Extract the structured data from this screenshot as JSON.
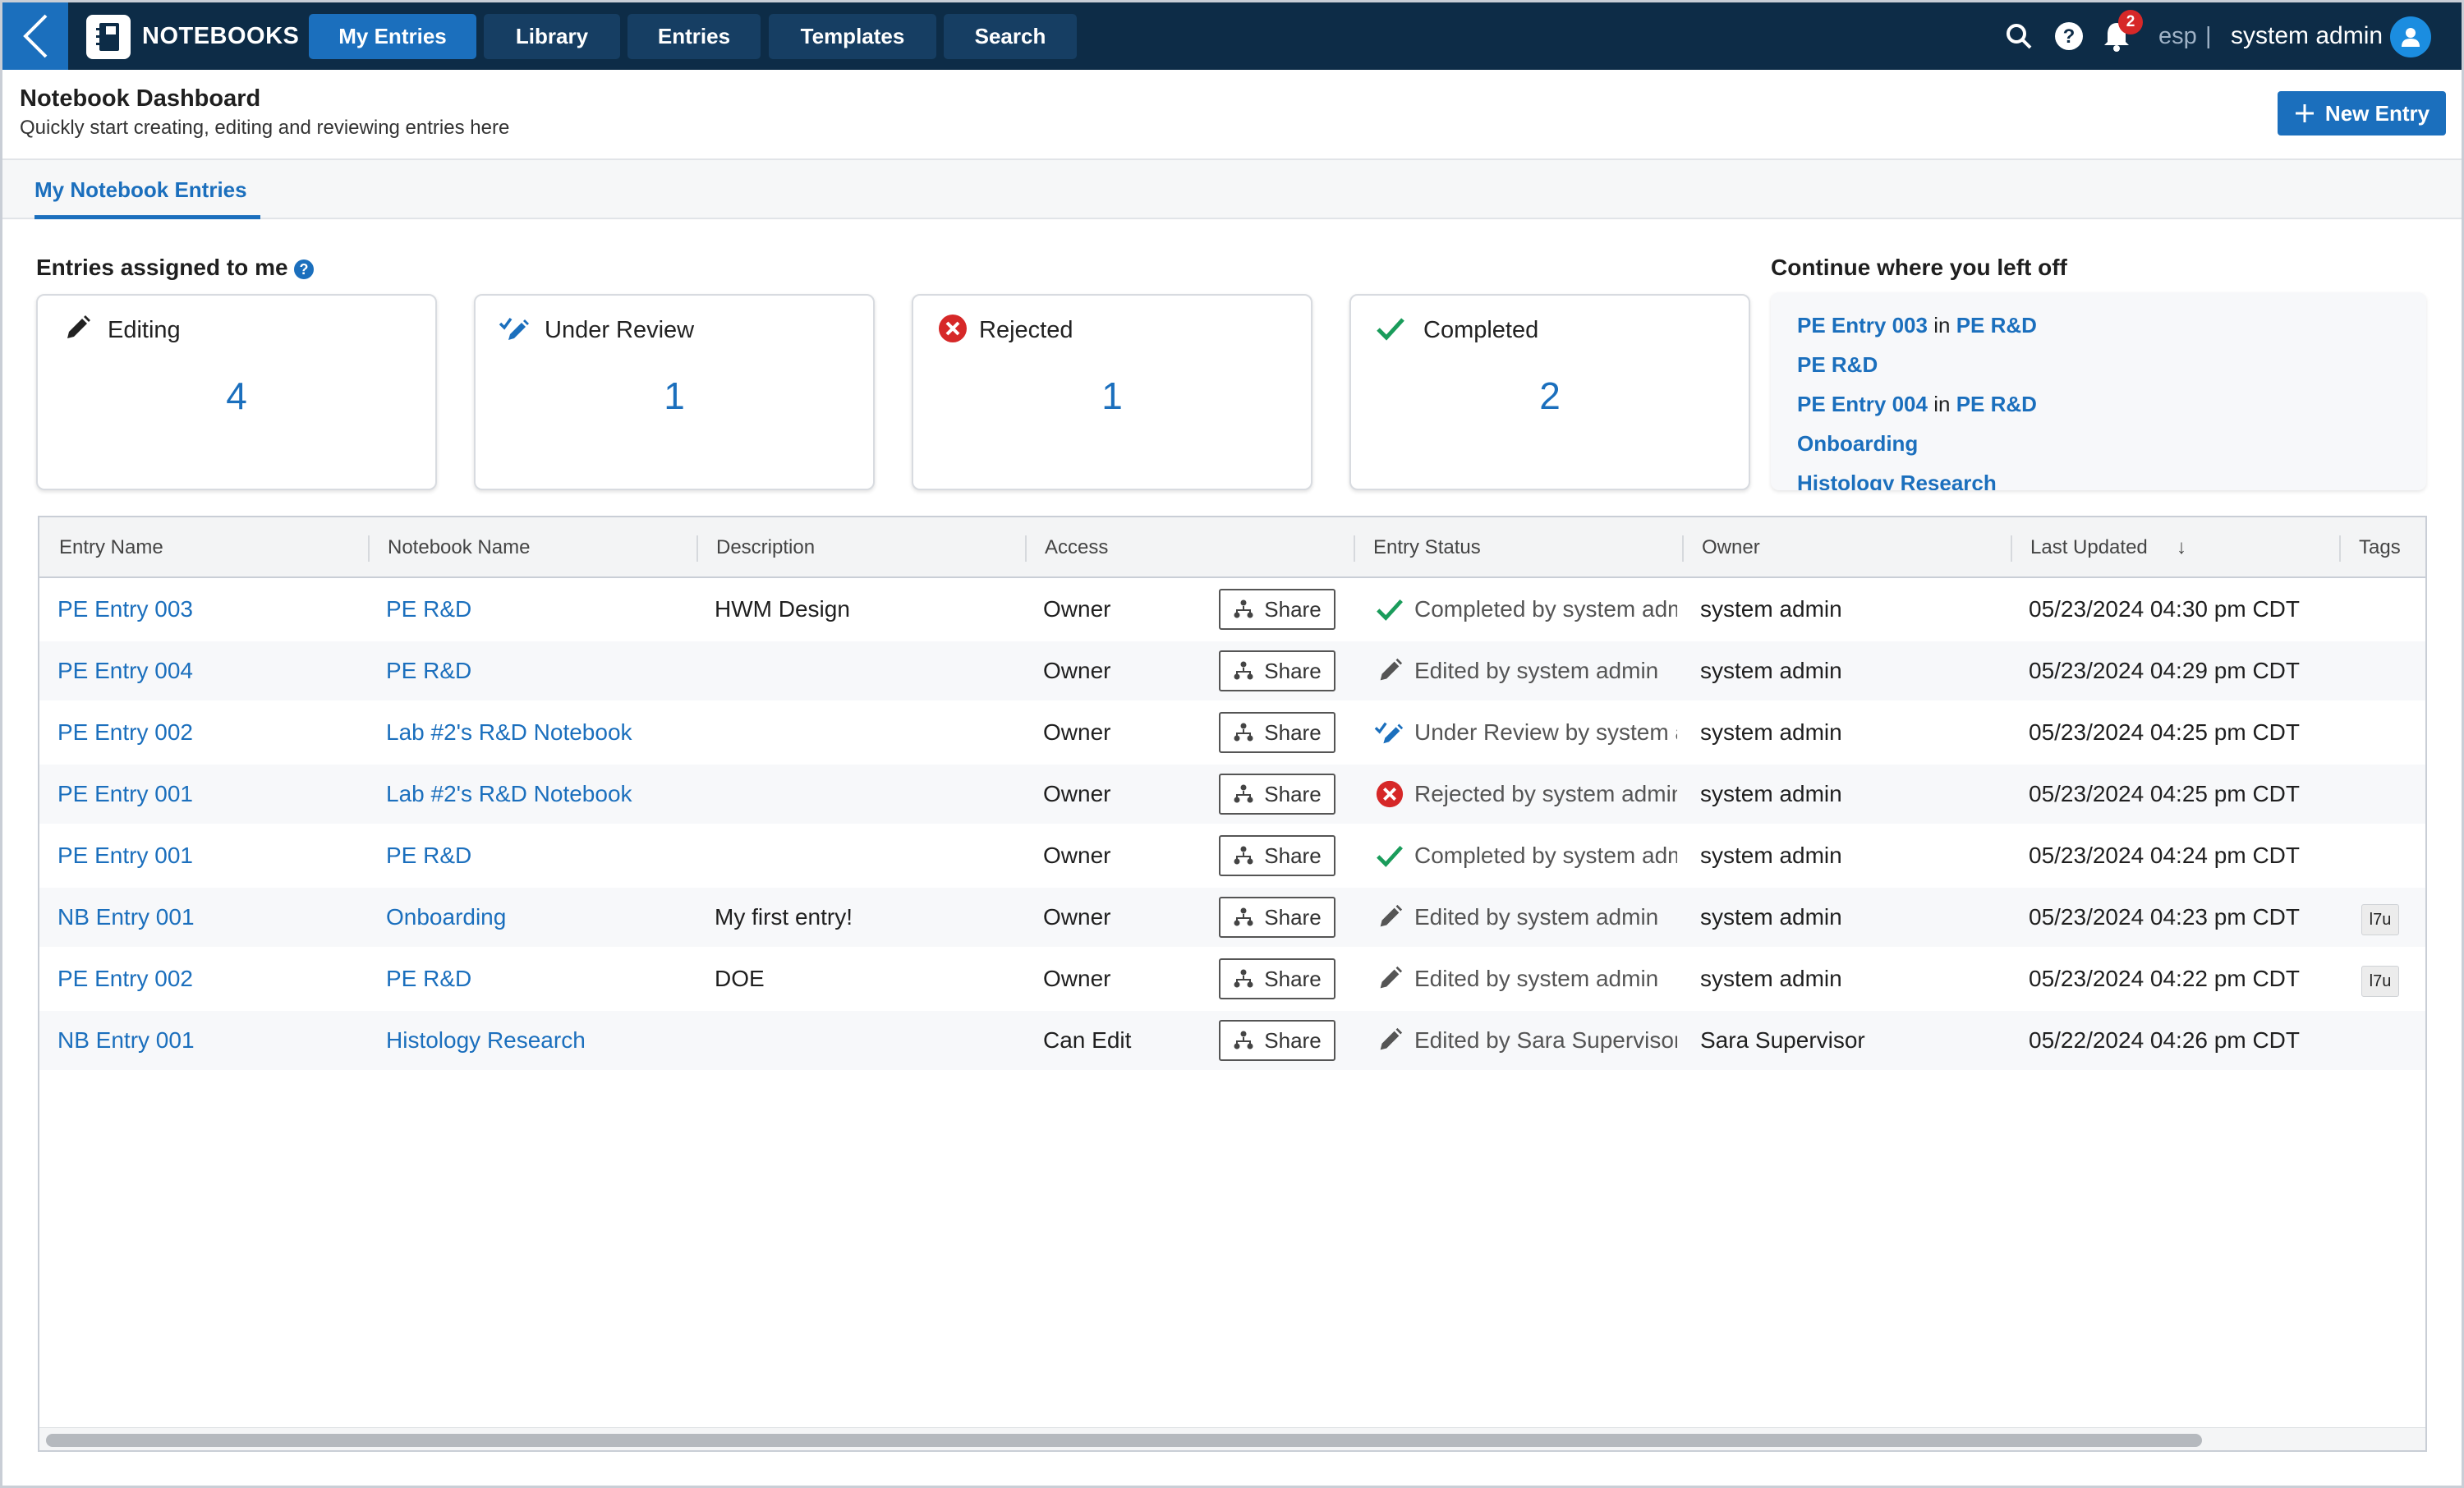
{
  "topbar": {
    "app_name": "NOTEBOOKS",
    "tabs": [
      {
        "label": "My Entries",
        "active": true
      },
      {
        "label": "Library",
        "active": false
      },
      {
        "label": "Entries",
        "active": false
      },
      {
        "label": "Templates",
        "active": false
      },
      {
        "label": "Search",
        "active": false
      }
    ],
    "notification_count": "2",
    "language": "esp",
    "separator": "|",
    "user": "system admin"
  },
  "header": {
    "title": "Notebook Dashboard",
    "subtitle": "Quickly start creating, editing and reviewing entries here",
    "new_entry_label": "New Entry"
  },
  "tabs": {
    "my_notebook_entries": "My Notebook Entries"
  },
  "summary": {
    "assigned_label": "Entries assigned to me",
    "help_glyph": "?",
    "cards": [
      {
        "label": "Editing",
        "count": "4",
        "icon": "pencil-icon"
      },
      {
        "label": "Under Review",
        "count": "1",
        "icon": "review-pen-icon"
      },
      {
        "label": "Rejected",
        "count": "1",
        "icon": "rejected-icon"
      },
      {
        "label": "Completed",
        "count": "2",
        "icon": "checkmark-icon"
      }
    ]
  },
  "continue": {
    "label": "Continue where you left off",
    "items": [
      {
        "entry": "PE Entry 003",
        "connector": "in",
        "notebook": "PE R&D"
      },
      {
        "entry": "PE R&D",
        "connector": "",
        "notebook": ""
      },
      {
        "entry": "PE Entry 004",
        "connector": "in",
        "notebook": "PE R&D"
      },
      {
        "entry": "Onboarding",
        "connector": "",
        "notebook": ""
      },
      {
        "entry": "Histology Research",
        "connector": "",
        "notebook": ""
      }
    ]
  },
  "table": {
    "columns": [
      "Entry Name",
      "Notebook Name",
      "Description",
      "Access",
      "Entry Status",
      "Owner",
      "Last Updated",
      "Tags"
    ],
    "sort_indicator": "↓",
    "share_label": "Share",
    "rows": [
      {
        "entry": "PE Entry 003",
        "notebook": "PE R&D",
        "description": "HWM Design",
        "access": "Owner",
        "status": "Completed by system admin",
        "status_icon": "checkmark-icon",
        "owner": "system admin",
        "updated": "05/23/2024 04:30 pm CDT",
        "tag": ""
      },
      {
        "entry": "PE Entry 004",
        "notebook": "PE R&D",
        "description": "",
        "access": "Owner",
        "status": "Edited by system admin",
        "status_icon": "pencil-icon",
        "owner": "system admin",
        "updated": "05/23/2024 04:29 pm CDT",
        "tag": ""
      },
      {
        "entry": "PE Entry 002",
        "notebook": "Lab #2's R&D Notebook",
        "description": "",
        "access": "Owner",
        "status": "Under Review by system admin",
        "status_icon": "review-pen-icon",
        "owner": "system admin",
        "updated": "05/23/2024 04:25 pm CDT",
        "tag": ""
      },
      {
        "entry": "PE Entry 001",
        "notebook": "Lab #2's R&D Notebook",
        "description": "",
        "access": "Owner",
        "status": "Rejected by system admin",
        "status_icon": "rejected-icon",
        "owner": "system admin",
        "updated": "05/23/2024 04:25 pm CDT",
        "tag": ""
      },
      {
        "entry": "PE Entry 001",
        "notebook": "PE R&D",
        "description": "",
        "access": "Owner",
        "status": "Completed by system admin",
        "status_icon": "checkmark-icon",
        "owner": "system admin",
        "updated": "05/23/2024 04:24 pm CDT",
        "tag": ""
      },
      {
        "entry": "NB Entry 001",
        "notebook": "Onboarding",
        "description": "My first entry!",
        "access": "Owner",
        "status": "Edited by system admin",
        "status_icon": "pencil-icon",
        "owner": "system admin",
        "updated": "05/23/2024 04:23 pm CDT",
        "tag": "l7u"
      },
      {
        "entry": "PE Entry 002",
        "notebook": "PE R&D",
        "description": "DOE",
        "access": "Owner",
        "status": "Edited by system admin",
        "status_icon": "pencil-icon",
        "owner": "system admin",
        "updated": "05/23/2024 04:22 pm CDT",
        "tag": "l7u"
      },
      {
        "entry": "NB Entry 001",
        "notebook": "Histology Research",
        "description": "",
        "access": "Can Edit",
        "status": "Edited by Sara Supervisor",
        "status_icon": "pencil-icon",
        "owner": "Sara Supervisor",
        "updated": "05/22/2024 04:26 pm CDT",
        "tag": ""
      }
    ]
  },
  "colors": {
    "topbar": "#0d2c47",
    "accent": "#1b6fbd",
    "completed": "#1a9c5b",
    "rejected": "#d62828"
  }
}
